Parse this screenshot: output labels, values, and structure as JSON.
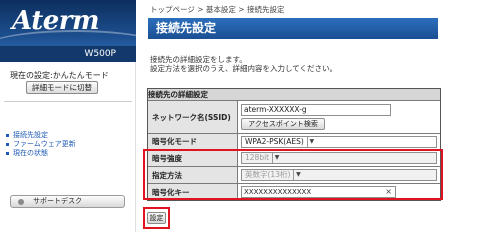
{
  "sidebar": {
    "logo": "Aterm",
    "model": "W500P",
    "current_mode": "現在の設定:かんたんモード",
    "mode_button": "詳細モードに切替",
    "nav": [
      {
        "label": "接続先設定"
      },
      {
        "label": "ファームウェア更新"
      },
      {
        "label": "現在の状態"
      }
    ],
    "support_button": "サポートデスク"
  },
  "breadcrumb": "トップページ > 基本設定 > 接続先設定",
  "page_title": "接続先設定",
  "description": {
    "line1": "接続先の詳細設定をします。",
    "line2": "設定方法を選択のうえ、詳細内容を入力してください。"
  },
  "settings": {
    "header": "接続先の詳細設定",
    "ssid": {
      "label": "ネットワーク名(SSID)",
      "value": "aterm-XXXXXX-g",
      "ap_button": "アクセスポイント検索"
    },
    "encryption_mode": {
      "label": "暗号化モード",
      "value": "WPA2-PSK(AES)"
    },
    "encryption_strength": {
      "label": "暗号強度",
      "value": "128bit"
    },
    "input_method": {
      "label": "指定方法",
      "value": "英数字(13桁)"
    },
    "encryption_key": {
      "label": "暗号化キー",
      "value": "XXXXXXXXXXXXXX",
      "clear": "×"
    }
  },
  "submit_button": "設定",
  "colors": {
    "title_band": "#1b4f93",
    "highlight": "#e0141e",
    "link": "#1d59b3"
  }
}
